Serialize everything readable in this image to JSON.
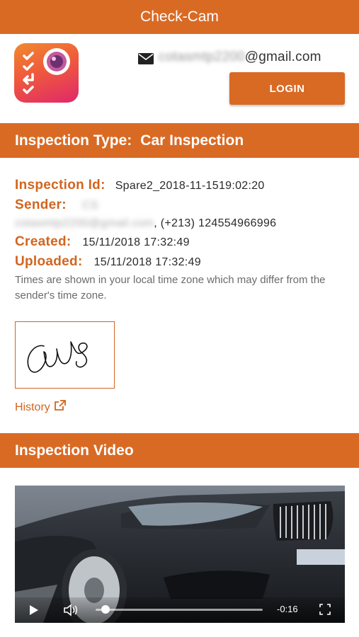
{
  "app": {
    "title": "Check-Cam"
  },
  "header": {
    "email_prefix": "cotasmtp2200",
    "email_domain": "@gmail.com",
    "login_label": "LOGIN"
  },
  "inspection": {
    "type_label": "Inspection Type:",
    "type_value": "Car Inspection",
    "id_label": "Inspection Id:",
    "id_value": "Spare2_2018-11-1519:02:20",
    "sender_label": "Sender:",
    "sender_value": "CS",
    "sender_email": "cotasmtp2200@gmail.com",
    "sender_phone": ", (+213) 124554966996",
    "created_label": "Created:",
    "created_value": "15/11/2018 17:32:49",
    "uploaded_label": "Uploaded:",
    "uploaded_value": "15/11/2018 17:32:49",
    "timezone_note": "Times are shown in your local time zone which may differ from the sender's time zone.",
    "history_label": "History"
  },
  "video": {
    "section_title": "Inspection Video",
    "time_remaining": "-0:16",
    "progress_fraction": 0.06
  },
  "colors": {
    "accent": "#d96a24",
    "label": "#d2651f"
  },
  "icons": {
    "mail": "envelope-icon",
    "external": "external-link-icon",
    "play": "play-icon",
    "volume": "volume-icon",
    "fullscreen": "fullscreen-icon"
  }
}
